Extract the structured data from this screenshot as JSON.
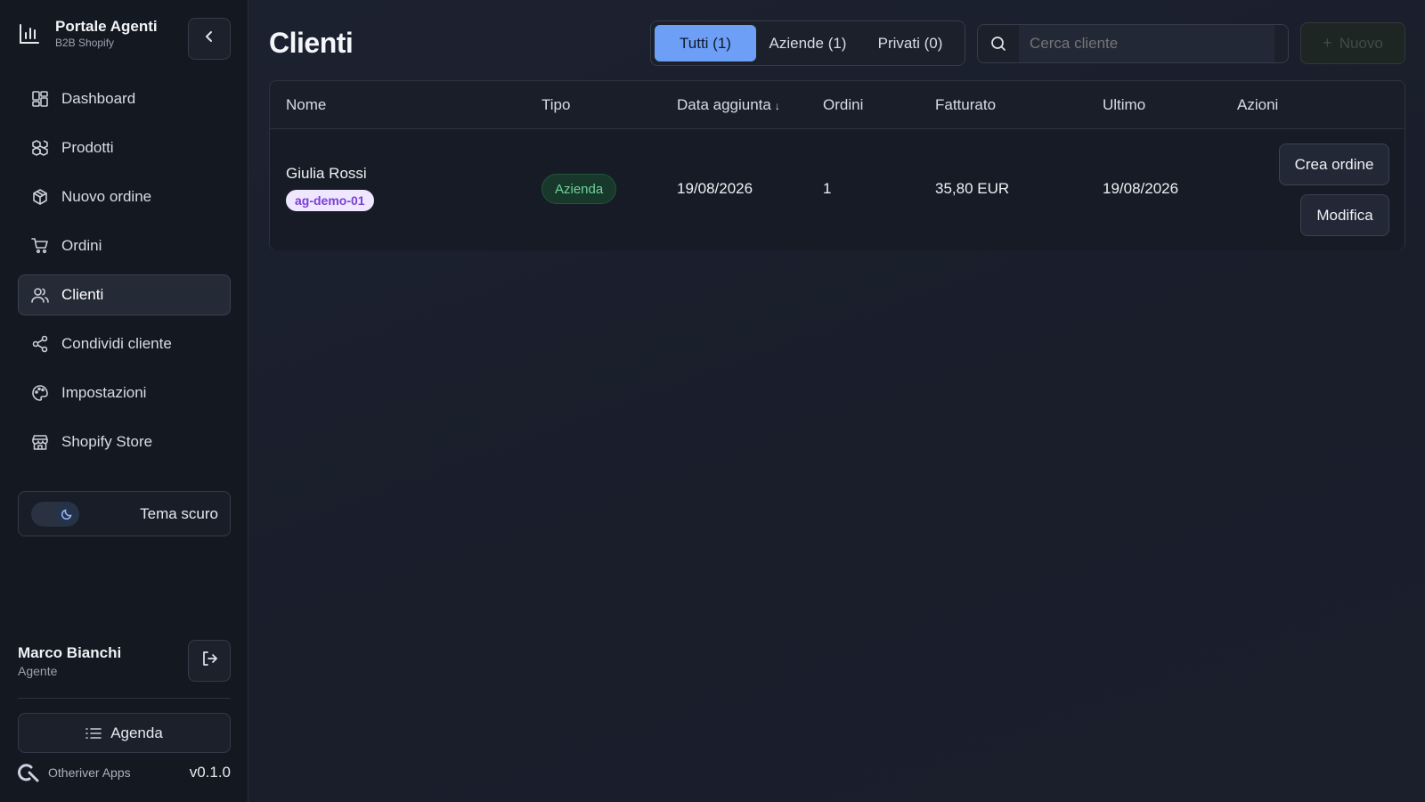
{
  "brand": {
    "title": "Portale Agenti",
    "subtitle": "B2B Shopify",
    "logo_icon": "bar-chart-icon"
  },
  "sidebar": {
    "items": [
      {
        "label": "Dashboard",
        "icon": "dashboard-icon",
        "active": false
      },
      {
        "label": "Prodotti",
        "icon": "boxes-icon",
        "active": false
      },
      {
        "label": "Nuovo ordine",
        "icon": "package-plus-icon",
        "active": false
      },
      {
        "label": "Ordini",
        "icon": "cart-icon",
        "active": false
      },
      {
        "label": "Clienti",
        "icon": "users-icon",
        "active": true
      },
      {
        "label": "Condividi cliente",
        "icon": "share-icon",
        "active": false
      },
      {
        "label": "Impostazioni",
        "icon": "palette-icon",
        "active": false
      },
      {
        "label": "Shopify Store",
        "icon": "store-icon",
        "active": false
      }
    ],
    "theme_label": "Tema scuro",
    "user": {
      "name": "Marco Bianchi",
      "role": "Agente"
    },
    "agenda_label": "Agenda",
    "footer": {
      "company": "Otheriver Apps",
      "version": "v0.1.0"
    }
  },
  "main": {
    "title": "Clienti",
    "filters": [
      "Tutti (1)",
      "Aziende (1)",
      "Privati (0)"
    ],
    "search_placeholder": "Cerca cliente",
    "new_label": "Nuovo",
    "columns": [
      "Nome",
      "Tipo",
      "Data aggiunta",
      "Ordini",
      "Fatturato",
      "Ultimo",
      "Azioni"
    ],
    "sort_indicator": "↓",
    "rows": [
      {
        "name": "Giulia Rossi",
        "agent_tag": "ag-demo-01",
        "type": "Azienda",
        "date_added": "19/08/2026",
        "orders": "1",
        "revenue": "35,80 EUR",
        "last": "19/08/2026",
        "action_create": "Crea ordine",
        "action_edit": "Modifica"
      }
    ]
  },
  "colors": {
    "accent": "#6c9ff5",
    "background": "#1a1f2a",
    "sidebar": "#141820",
    "tag_bg": "#efe6ff",
    "tag_text": "#7a3fd6",
    "badge_text": "#6fd39b"
  }
}
